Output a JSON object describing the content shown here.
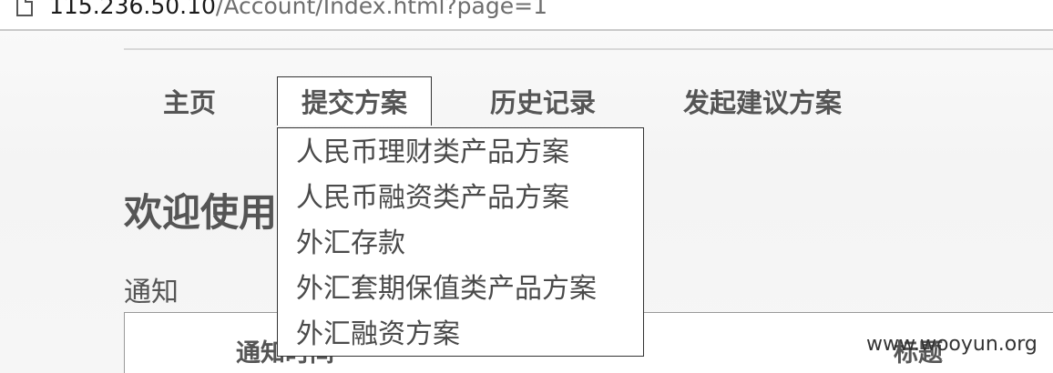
{
  "browser": {
    "url_host": "115.236.50.10",
    "url_path": "/Account/Index.html?page=1",
    "page_icon": "page-icon"
  },
  "nav": {
    "items": [
      {
        "label": "主页"
      },
      {
        "label": "提交方案"
      },
      {
        "label": "历史记录"
      },
      {
        "label": "发起建议方案"
      }
    ]
  },
  "dropdown": {
    "items": [
      {
        "label": "人民币理财类产品方案"
      },
      {
        "label": "人民币融资类产品方案"
      },
      {
        "label": "外汇存款"
      },
      {
        "label": "外汇套期保值类产品方案"
      },
      {
        "label": "外汇融资方案"
      }
    ]
  },
  "main": {
    "welcome_title": "欢迎使用",
    "notice_label": "通知",
    "table_headers": {
      "time": "通知时间",
      "title": "标题"
    }
  },
  "watermark": "www.wooyun.org"
}
